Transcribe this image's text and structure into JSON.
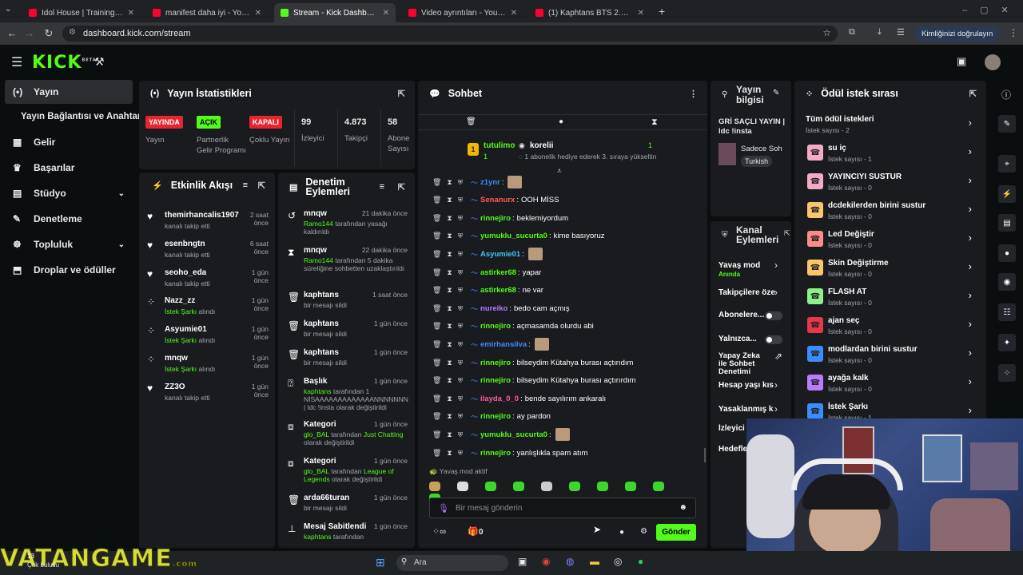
{
  "browser": {
    "tabs": [
      {
        "title": "Idol House | Training 04 | Eğitim",
        "color": "#ff0033"
      },
      {
        "title": "manifest daha iyi - YouTube",
        "color": "#ff0033"
      },
      {
        "title": "Stream - Kick Dashboard",
        "color": "#53fc18"
      },
      {
        "title": "Video ayrıntıları - YouTube Stud",
        "color": "#ff0033"
      },
      {
        "title": "(1) Kaphtans BTS 2.0 MV İZLİYO",
        "color": "#ff0033"
      }
    ],
    "url": "dashboard.kick.com/stream",
    "verify_label": "Kimliğinizi doğrulayın"
  },
  "brand": {
    "logo": "KICK",
    "beta": "BETA",
    "accent": "#53fc18"
  },
  "sidebar": {
    "items": [
      {
        "label": "Yayın",
        "icon": "broadcast-icon"
      },
      {
        "label": "Yayın Bağlantısı ve Anahtarı",
        "icon": ""
      },
      {
        "label": "Gelir",
        "icon": "revenue-icon"
      },
      {
        "label": "Başarılar",
        "icon": "trophy-icon"
      },
      {
        "label": "Stüdyo",
        "icon": "studio-icon"
      },
      {
        "label": "Denetleme",
        "icon": "wrench-icon"
      },
      {
        "label": "Topluluk",
        "icon": "community-icon"
      },
      {
        "label": "Droplar ve ödüller",
        "icon": "drops-icon"
      }
    ]
  },
  "stats": {
    "title": "Yayın İstatistikleri",
    "cols": [
      {
        "badge": "YAYINDA",
        "label": "Yayın"
      },
      {
        "badge": "AÇIK",
        "label": "Partnerlik Gelir Programı"
      },
      {
        "badge": "KAPALI",
        "label": "Çoklu Yayın"
      },
      {
        "value": "99",
        "label": "İzleyici"
      },
      {
        "value": "4.873",
        "label": "Takipçi"
      },
      {
        "value": "58",
        "label": "Abone Sayısı"
      }
    ]
  },
  "activity": {
    "title": "Etkinlik Akışı",
    "items": [
      {
        "name": "themirhancalis1907",
        "sub": "kanalı takip etti",
        "time": "2 saat önce",
        "icon": "heart-icon"
      },
      {
        "name": "esenbngtn",
        "sub": "kanalı takip etti",
        "time": "6 saat önce",
        "icon": "heart-icon"
      },
      {
        "name": "seoho_eda",
        "sub": "kanalı takip etti",
        "time": "1 gün önce",
        "icon": "heart-icon"
      },
      {
        "name": "Nazz_zz",
        "sub": "İstek Şarkı",
        "sub2": "alındı",
        "time": "1 gün önce",
        "icon": "reward-icon"
      },
      {
        "name": "Asyumie01",
        "sub": "İstek Şarkı",
        "sub2": "alındı",
        "time": "1 gün önce",
        "icon": "reward-icon"
      },
      {
        "name": "mnqw",
        "sub": "İstek Şarkı",
        "sub2": "alındı",
        "time": "1 gün önce",
        "icon": "reward-icon"
      },
      {
        "name": "ZZ3O",
        "sub": "kanalı takip etti",
        "time": "1 gün önce",
        "icon": "heart-icon"
      }
    ]
  },
  "modlog": {
    "title": "Denetim Eylemleri",
    "items": [
      {
        "name": "mnqw",
        "time": "21 dakika önce",
        "actor": "Ramo144",
        "text": "tarafından yasağı kaldırıldı"
      },
      {
        "name": "mnqw",
        "time": "22 dakika önce",
        "actor": "Ramo144",
        "text": "tarafından 5 dakika süreliğine sohbetten uzaklaştırıldı"
      },
      {
        "name": "kaphtans",
        "time": "1 saat önce",
        "text": "bir mesajı sildi"
      },
      {
        "name": "kaphtans",
        "time": "1 gün önce",
        "text": "bir mesajı sildi"
      },
      {
        "name": "kaphtans",
        "time": "1 gün önce",
        "text": "bir mesajı sildi"
      },
      {
        "name": "Başlık",
        "time": "1 gün önce",
        "actor": "kaphtans",
        "text": "tarafından 1 NİSAAAAAAAAAAAAANNNNNNN | ldc !insta olarak değiştirildi"
      },
      {
        "name": "Kategori",
        "time": "1 gün önce",
        "actor": "glo_BAL",
        "text": "tarafından",
        "hl": "Just Chatting",
        "text2": "olarak değiştirildi"
      },
      {
        "name": "Kategori",
        "time": "1 gün önce",
        "actor": "glo_BAL",
        "text": "tarafından",
        "hl": "League of Legends",
        "text2": "olarak değiştirildi"
      },
      {
        "name": "arda66turan",
        "time": "1 gün önce",
        "text": "bir mesajı sildi"
      },
      {
        "name": "Mesaj Sabitlendi",
        "time": "1 gün önce",
        "actor": "kaphtans",
        "text": "tarafından"
      }
    ]
  },
  "chat": {
    "title": "Sohbet",
    "pinned": {
      "user1": "tutulimo",
      "count1": "1",
      "user2": "korelii",
      "count2": "1",
      "text": "1 abonelik hediye ederek 3. sıraya yükseltin"
    },
    "messages": [
      {
        "user": "z1ynr",
        "color": "#3a8dff",
        "text": "",
        "emote": true
      },
      {
        "user": "Senanurx",
        "color": "#ff5a5a",
        "text": "OOH MİSS"
      },
      {
        "user": "rinnejiro",
        "color": "#53fc18",
        "text": "beklemiyordum"
      },
      {
        "user": "yumuklu_sucurta0",
        "color": "#53fc18",
        "text": "kime basıyoruz"
      },
      {
        "user": "Asyumie01",
        "color": "#3ec6ff",
        "text": "",
        "emote": true
      },
      {
        "user": "astirker68",
        "color": "#53fc18",
        "text": "yapar"
      },
      {
        "user": "astirker68",
        "color": "#53fc18",
        "text": "ne var"
      },
      {
        "user": "nureiko",
        "color": "#b77cff",
        "text": "bedo cam açmış"
      },
      {
        "user": "rinnejiro",
        "color": "#53fc18",
        "text": "açmasamda olurdu abi"
      },
      {
        "user": "emirhansilva",
        "color": "#3a8dff",
        "text": "",
        "emote": true
      },
      {
        "user": "rinnejiro",
        "color": "#53fc18",
        "text": "bilseydim Kütahya burası açtırıdım"
      },
      {
        "user": "rinnejiro",
        "color": "#53fc18",
        "text": "bilseydim Kütahya burası açtırırdım"
      },
      {
        "user": "ilayda_0_0",
        "color": "#ff5a9e",
        "text": "bende sayılırım ankaralı"
      },
      {
        "user": "rinnejiro",
        "color": "#53fc18",
        "text": "ay pardon"
      },
      {
        "user": "yumuklu_sucurta0",
        "color": "#53fc18",
        "text": "",
        "emote": true
      },
      {
        "user": "rinnejiro",
        "color": "#53fc18",
        "text": "yanlışlıkla spam atım"
      }
    ],
    "slow_mode": "Yavaş mod aktif",
    "placeholder": "Bir mesaj gönderin",
    "points": "0",
    "send": "Gönder"
  },
  "stream_info": {
    "title": "Yayın bilgisi",
    "stream_title": "GRİ SAÇLI YAYIN | ldc !insta",
    "category": "Sadece Soh",
    "tag": "Turkish"
  },
  "channel_actions": {
    "title": "Kanal Eylemleri",
    "items": [
      {
        "label": "Yavaş mod",
        "sub": "Anında"
      },
      {
        "label": "Takipçilere öze"
      },
      {
        "label": "Abonelere..."
      },
      {
        "label": "Yalnızca..."
      },
      {
        "label": "Yapay Zeka ile Sohbet Denetimi"
      },
      {
        "label": "Hesap yaşı kıs"
      },
      {
        "label": "Yasaklanmış k"
      },
      {
        "label": "İzleyici"
      },
      {
        "label": "Hedefle"
      }
    ]
  },
  "rewards": {
    "title": "Ödül istek sırası",
    "all_label": "Tüm ödül istekleri",
    "all_count": "İstek sayısı - 2",
    "items": [
      {
        "title": "su iç",
        "count": "İstek sayısı - 1",
        "color": "#f4a9c6"
      },
      {
        "title": "YAYINCIYI SUSTUR",
        "count": "İstek sayısı - 0",
        "color": "#f4a9c6"
      },
      {
        "title": "dcdekilerden birini sustur",
        "count": "İstek sayısı - 0",
        "color": "#f7c66d"
      },
      {
        "title": "Led Değiştir",
        "count": "İstek sayısı - 0",
        "color": "#ff8a8a"
      },
      {
        "title": "Skin Değiştirme",
        "count": "İstek sayısı - 0",
        "color": "#f7c66d"
      },
      {
        "title": "FLASH AT",
        "count": "İstek sayısı - 0",
        "color": "#8ef08a"
      },
      {
        "title": "ajan seç",
        "count": "İstek sayısı - 0",
        "color": "#e8364a"
      },
      {
        "title": "modlardan birini sustur",
        "count": "İstek sayısı - 0",
        "color": "#3a8dff"
      },
      {
        "title": "ayağa kalk",
        "count": "İstek sayısı - 0",
        "color": "#b77cff"
      },
      {
        "title": "İstek Şarkı",
        "count": "İstek sayısı - 1",
        "color": "#3a8dff"
      }
    ]
  },
  "taskbar": {
    "search": "Ara",
    "watermark": "VATANGAME",
    "watermark_sub": ".com",
    "corner": "13",
    "corner_sub": "Çok bulutlu"
  }
}
